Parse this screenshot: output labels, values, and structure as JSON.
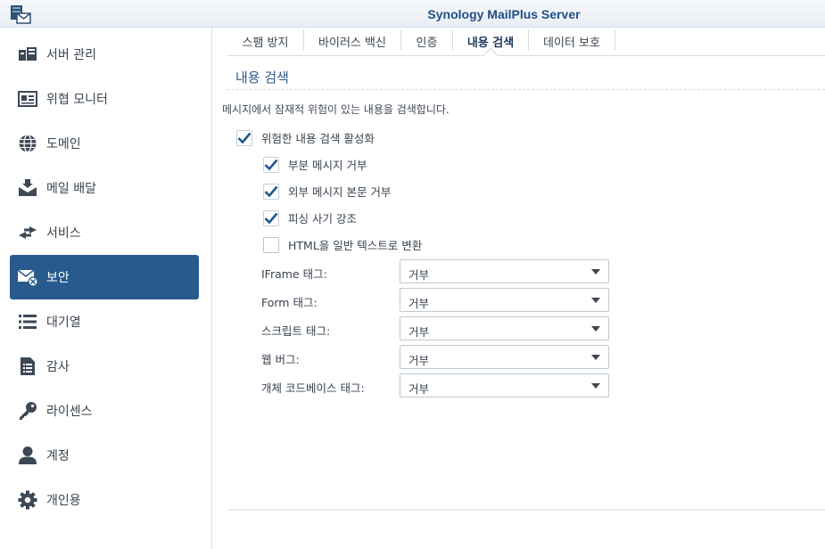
{
  "app": {
    "title": "Synology MailPlus Server",
    "logo_icon": "mailplus-server-logo-icon"
  },
  "sidebar": {
    "items": [
      {
        "label": "서버 관리",
        "icon": "server-icon",
        "active": false
      },
      {
        "label": "위협 모니터",
        "icon": "monitor-card-icon",
        "active": false
      },
      {
        "label": "도메인",
        "icon": "globe-icon",
        "active": false
      },
      {
        "label": "메일 배달",
        "icon": "mail-delivery-icon",
        "active": false
      },
      {
        "label": "서비스",
        "icon": "exchange-arrows-icon",
        "active": false
      },
      {
        "label": "보안",
        "icon": "mail-shield-icon",
        "active": true
      },
      {
        "label": "대기열",
        "icon": "list-icon",
        "active": false
      },
      {
        "label": "감사",
        "icon": "audit-document-icon",
        "active": false
      },
      {
        "label": "라이센스",
        "icon": "key-icon",
        "active": false
      },
      {
        "label": "계정",
        "icon": "user-icon",
        "active": false
      },
      {
        "label": "개인용",
        "icon": "gear-icon",
        "active": false
      }
    ]
  },
  "tabs": [
    {
      "label": "스팸 방지",
      "active": false
    },
    {
      "label": "바이러스 백신",
      "active": false
    },
    {
      "label": "인증",
      "active": false
    },
    {
      "label": "내용 검색",
      "active": true
    },
    {
      "label": "데이터 보호",
      "active": false
    }
  ],
  "content": {
    "section_title": "내용 검색",
    "description": "메시지에서 잠재적 위험이 있는 내용을 검색합니다.",
    "main_checkbox": {
      "label": "위험한 내용 검색 활성화",
      "checked": true
    },
    "sub_checkboxes": [
      {
        "label": "부분 메시지 거부",
        "checked": true
      },
      {
        "label": "외부 메시지 본문 거부",
        "checked": true
      },
      {
        "label": "피싱 사기 강조",
        "checked": true
      },
      {
        "label": "HTML을 일반 텍스트로 변환",
        "checked": false
      }
    ],
    "fields": [
      {
        "label": "IFrame 태그:",
        "value": "거부"
      },
      {
        "label": "Form 태그:",
        "value": "거부"
      },
      {
        "label": "스크립트 태그:",
        "value": "거부"
      },
      {
        "label": "웹 버그:",
        "value": "거부"
      },
      {
        "label": "개체 코드베이스 태그:",
        "value": "거부"
      }
    ]
  },
  "colors": {
    "accent": "#295a8d",
    "title": "#1f4f86",
    "check": "#1f5690"
  }
}
